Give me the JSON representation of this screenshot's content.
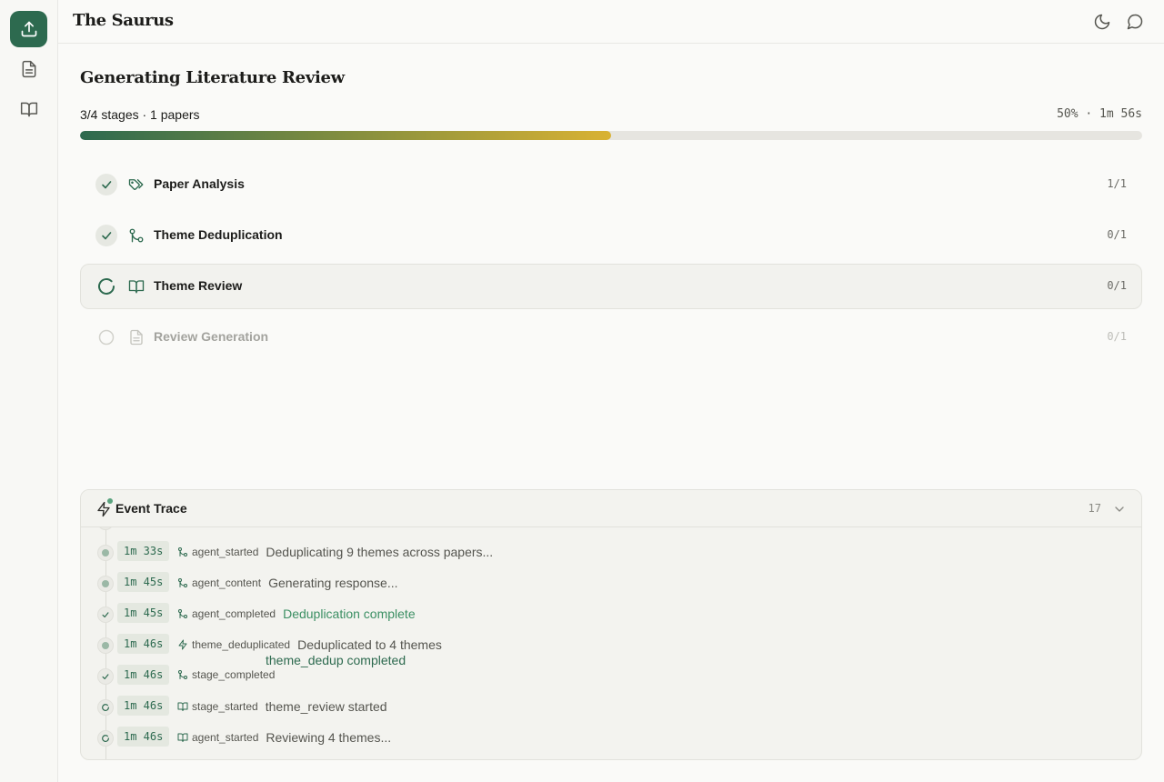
{
  "app": {
    "title": "The Saurus"
  },
  "sidebar": {
    "items": [
      {
        "name": "upload",
        "icon": "upload-icon",
        "active": true
      },
      {
        "name": "documents",
        "icon": "document-icon",
        "active": false
      },
      {
        "name": "library",
        "icon": "book-open-icon",
        "active": false
      }
    ]
  },
  "header": {
    "icons": [
      "moon-icon",
      "chat-icon"
    ]
  },
  "page": {
    "title": "Generating Literature Review",
    "summary": "3/4 stages · 1 papers",
    "progress_label": "50% · 1m 56s",
    "progress_percent": 50
  },
  "stages": [
    {
      "label": "Paper Analysis",
      "count": "1/1",
      "status": "done",
      "icon": "tags-icon"
    },
    {
      "label": "Theme Deduplication",
      "count": "0/1",
      "status": "done",
      "icon": "git-merge-icon"
    },
    {
      "label": "Theme Review",
      "count": "0/1",
      "status": "active",
      "icon": "book-open-icon"
    },
    {
      "label": "Review Generation",
      "count": "0/1",
      "status": "pending",
      "icon": "file-text-icon"
    }
  ],
  "trace": {
    "title": "Event Trace",
    "count": "17",
    "events": [
      {
        "time": "1m 33s",
        "type": "agent_started",
        "message": "Deduplicating 9 themes across papers...",
        "marker": "dot",
        "icon": "git-merge-icon",
        "tone": "normal"
      },
      {
        "time": "1m 45s",
        "type": "agent_content",
        "message": "Generating response...",
        "marker": "dot",
        "icon": "git-merge-icon",
        "tone": "normal"
      },
      {
        "time": "1m 45s",
        "type": "agent_completed",
        "message": "Deduplication complete",
        "marker": "check",
        "icon": "git-merge-icon",
        "tone": "ok"
      },
      {
        "time": "1m 46s",
        "type": "theme_deduplicated",
        "message": "Deduplicated to 4 themes",
        "marker": "dot",
        "icon": "bolt-icon",
        "tone": "normal"
      },
      {
        "time": "1m 46s",
        "type": "stage_completed",
        "message": "theme_dedup completed",
        "marker": "check",
        "icon": "git-merge-icon",
        "tone": "stage"
      },
      {
        "time": "1m 46s",
        "type": "stage_started",
        "message": "theme_review started",
        "marker": "spinner",
        "icon": "book-open-icon",
        "tone": "normal"
      },
      {
        "time": "1m 46s",
        "type": "agent_started",
        "message": "Reviewing 4 themes...",
        "marker": "spinner",
        "icon": "book-open-icon",
        "tone": "normal"
      }
    ]
  },
  "colors": {
    "accent": "#2d6a4f",
    "progress_end": "#d9b233",
    "success_text": "#3b8f63"
  }
}
